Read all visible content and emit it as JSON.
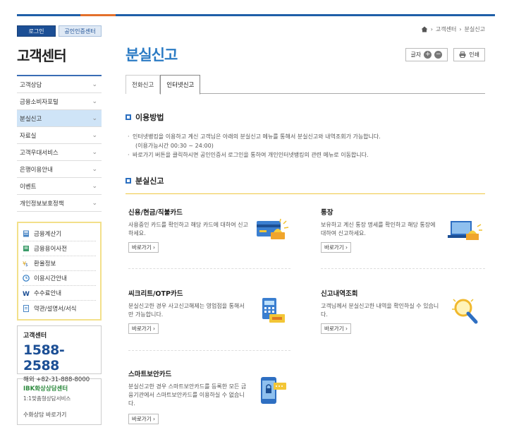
{
  "left": {
    "login_label": "로그인",
    "cert_label": "공인인증센터",
    "title": "고객센터",
    "menu": [
      {
        "label": "고객상담",
        "active": false
      },
      {
        "label": "금융소비자포털",
        "active": false
      },
      {
        "label": "분실신고",
        "active": true
      },
      {
        "label": "자료실",
        "active": false
      },
      {
        "label": "고객우대서비스",
        "active": false
      },
      {
        "label": "은행이용안내",
        "active": false
      },
      {
        "label": "이벤트",
        "active": false
      },
      {
        "label": "개인정보보호정책",
        "active": false
      }
    ],
    "quick_links": [
      {
        "label": "금융계산기",
        "icon": "calculator-icon"
      },
      {
        "label": "금융용어사전",
        "icon": "book-icon"
      },
      {
        "label": "환율정보",
        "icon": "exchange-icon"
      },
      {
        "label": "이용시간안내",
        "icon": "clock-icon"
      },
      {
        "label": "수수료안내",
        "icon": "won-icon"
      },
      {
        "label": "약관/설명서/서식",
        "icon": "document-icon"
      }
    ],
    "cs_title": "고객센터",
    "cs_phone": "1588-2588",
    "cs_intl": "해외 +82-31-888-8000",
    "ibk_title": "IBK화상상담센터",
    "ibk_sub": "1:1맞춤형상담서비스",
    "ibk_link": "수화상담 바로가기"
  },
  "main": {
    "breadcrumb": [
      "고객센터",
      "분실신고"
    ],
    "title": "분실신고",
    "font_label": "글자",
    "print_label": "인쇄",
    "tabs": [
      {
        "label": "전화신고",
        "active": false
      },
      {
        "label": "인터넷신고",
        "active": true
      }
    ],
    "usage_title": "이용방법",
    "usage_lines": [
      "인터넷뱅킹을 이용하고 계신 고객님은 아래의 분실신고 메뉴를 통해서 분실신고와 내역조회가 가능합니다.",
      "(이용가능시간 00:30 ~ 24:00)",
      "바로가기 버튼을 클릭하시면 공인인증서 로그인을 통하여 개인인터넷뱅킹의 관련 메뉴로 이동합니다."
    ],
    "report_title": "분실신고",
    "go_label": "바로가기 ›",
    "cards": [
      {
        "title": "신용/현금/직불카드",
        "desc": "사용중인 카드를 확인하고 해당 카드에 대하여 신고하세요.",
        "icon": "card-alarm-icon"
      },
      {
        "title": "통장",
        "desc": "보유하고 계신 통장 명세를 확인하고 해당 통장에 대하여 신고하세요.",
        "icon": "laptop-alarm-icon"
      },
      {
        "title": "씨크리트/OTP카드",
        "desc": "분실신고한 경우 사고신고해제는 영업점을 통해서만 가능합니다.",
        "icon": "otp-card-icon"
      },
      {
        "title": "신고내역조회",
        "desc": "고객님께서 분실신고한 내역을 확인하실 수 있습니다.",
        "icon": "magnifier-icon"
      },
      {
        "title": "스마트보안카드",
        "desc": "분실신고한 경우 스마트보안카드를 등록한 모든 금융기관에서 스마트보안카드를 이용하실 수 없습니다.",
        "icon": "smart-card-icon"
      }
    ]
  }
}
